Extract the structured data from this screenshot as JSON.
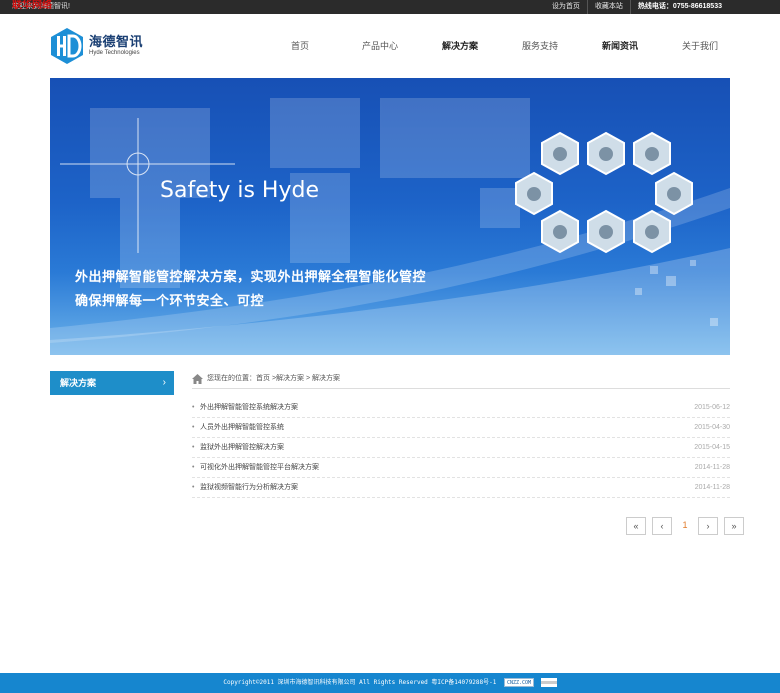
{
  "topbar": {
    "welcome": "欢迎来到海德智讯!",
    "overlay_text": "联华网络",
    "links": [
      "设为首页",
      "收藏本站"
    ],
    "phone": "热线电话：0755-86618533"
  },
  "logo": {
    "mark": "HD",
    "name_cn": "海德智讯",
    "name_en": "Hyde Technologies"
  },
  "nav": {
    "items": [
      "首页",
      "产品中心",
      "解决方案",
      "服务支持",
      "新闻资讯",
      "关于我们"
    ]
  },
  "banner": {
    "slogan": "Safety is Hyde",
    "line1": "外出押解智能管控解决方案，实现外出押解全程智能化管控",
    "line2": "确保押解每一个环节安全、可控"
  },
  "sidebar": {
    "tab_label": "解决方案",
    "tab_chevron": "›"
  },
  "breadcrumb": {
    "text": "您现在的位置：首页 >解决方案 > 解决方案"
  },
  "list": {
    "items": [
      {
        "title": "外出押解智能管控系统解决方案",
        "date": "2015-06-12"
      },
      {
        "title": "人员外出押解智能管控系统",
        "date": "2015-04-30"
      },
      {
        "title": "监狱外出押解管控解决方案",
        "date": "2015-04-15"
      },
      {
        "title": "可视化外出押解智能管控平台解决方案",
        "date": "2014-11-28"
      },
      {
        "title": "监狱视频智能行为分析解决方案",
        "date": "2014-11-28"
      }
    ]
  },
  "pager": {
    "first": "«",
    "prev": "‹",
    "current": "1",
    "next": "›",
    "last": "»"
  },
  "footer": {
    "text": "Copyright©2011 深圳市海德智讯科技有限公司 All Rights Reserved 粤ICP备14079288号-1",
    "badge": "CNZZ.COM"
  },
  "colors": {
    "accent": "#1e8ec9",
    "footer": "#1686cf",
    "topbar": "#2b2b2b",
    "current_page": "#e07b2a"
  }
}
